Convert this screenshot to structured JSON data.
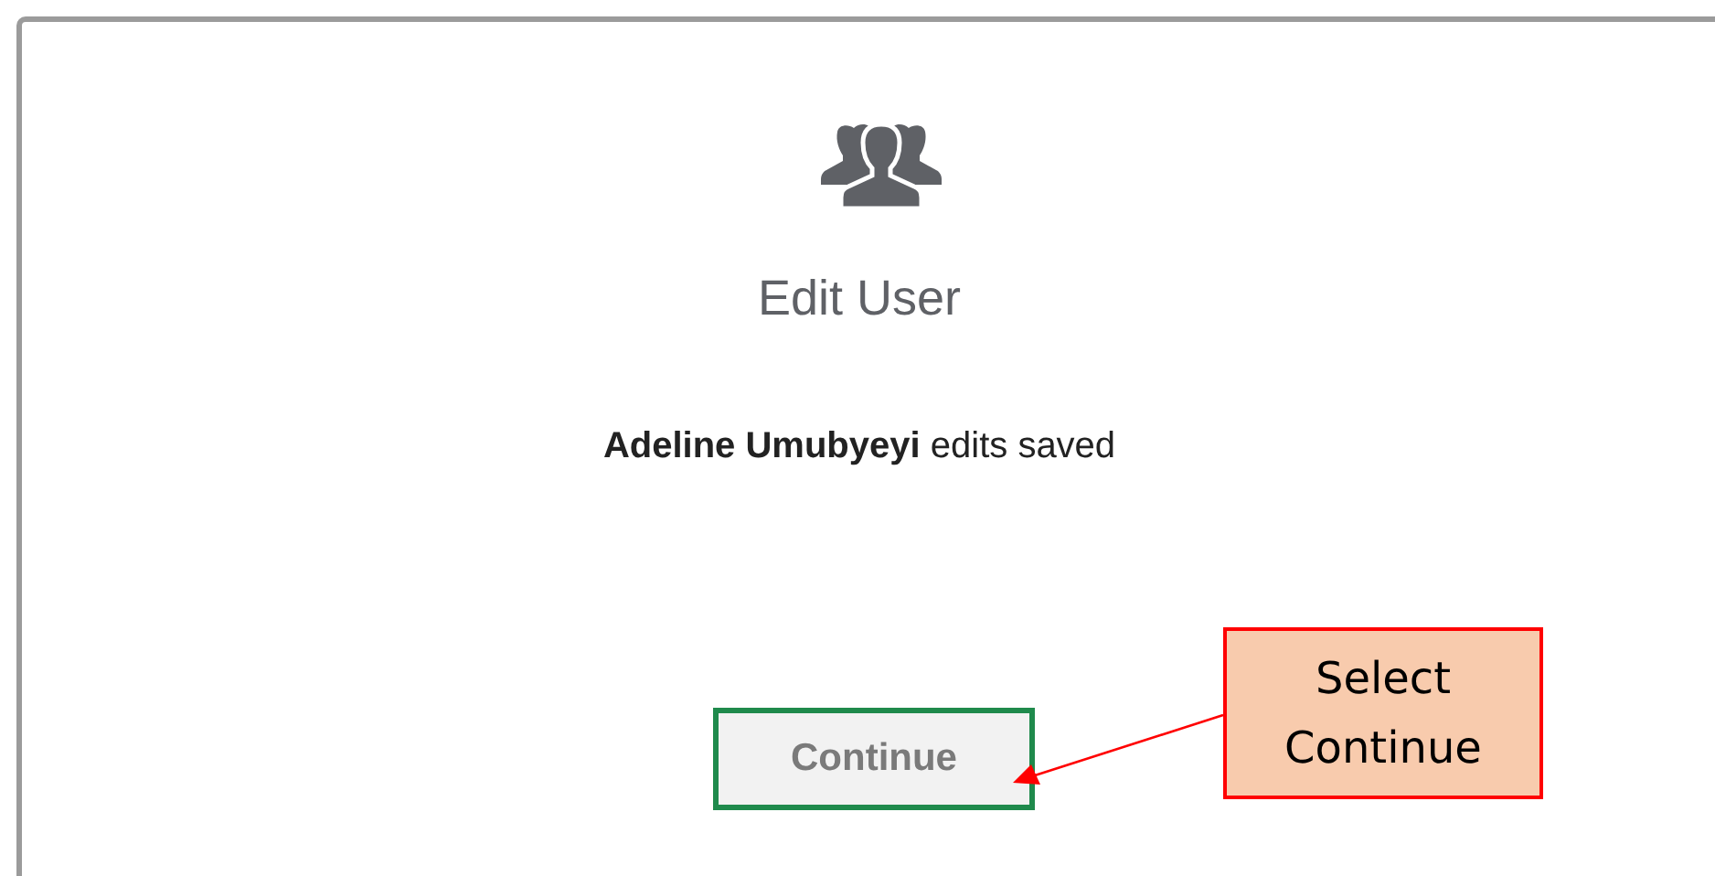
{
  "dialog": {
    "title": "Edit User",
    "message": "**Adeline Umubyeyi** edits saved",
    "button": "Continue"
  },
  "callout": {
    "text": "Select Continue"
  }
}
